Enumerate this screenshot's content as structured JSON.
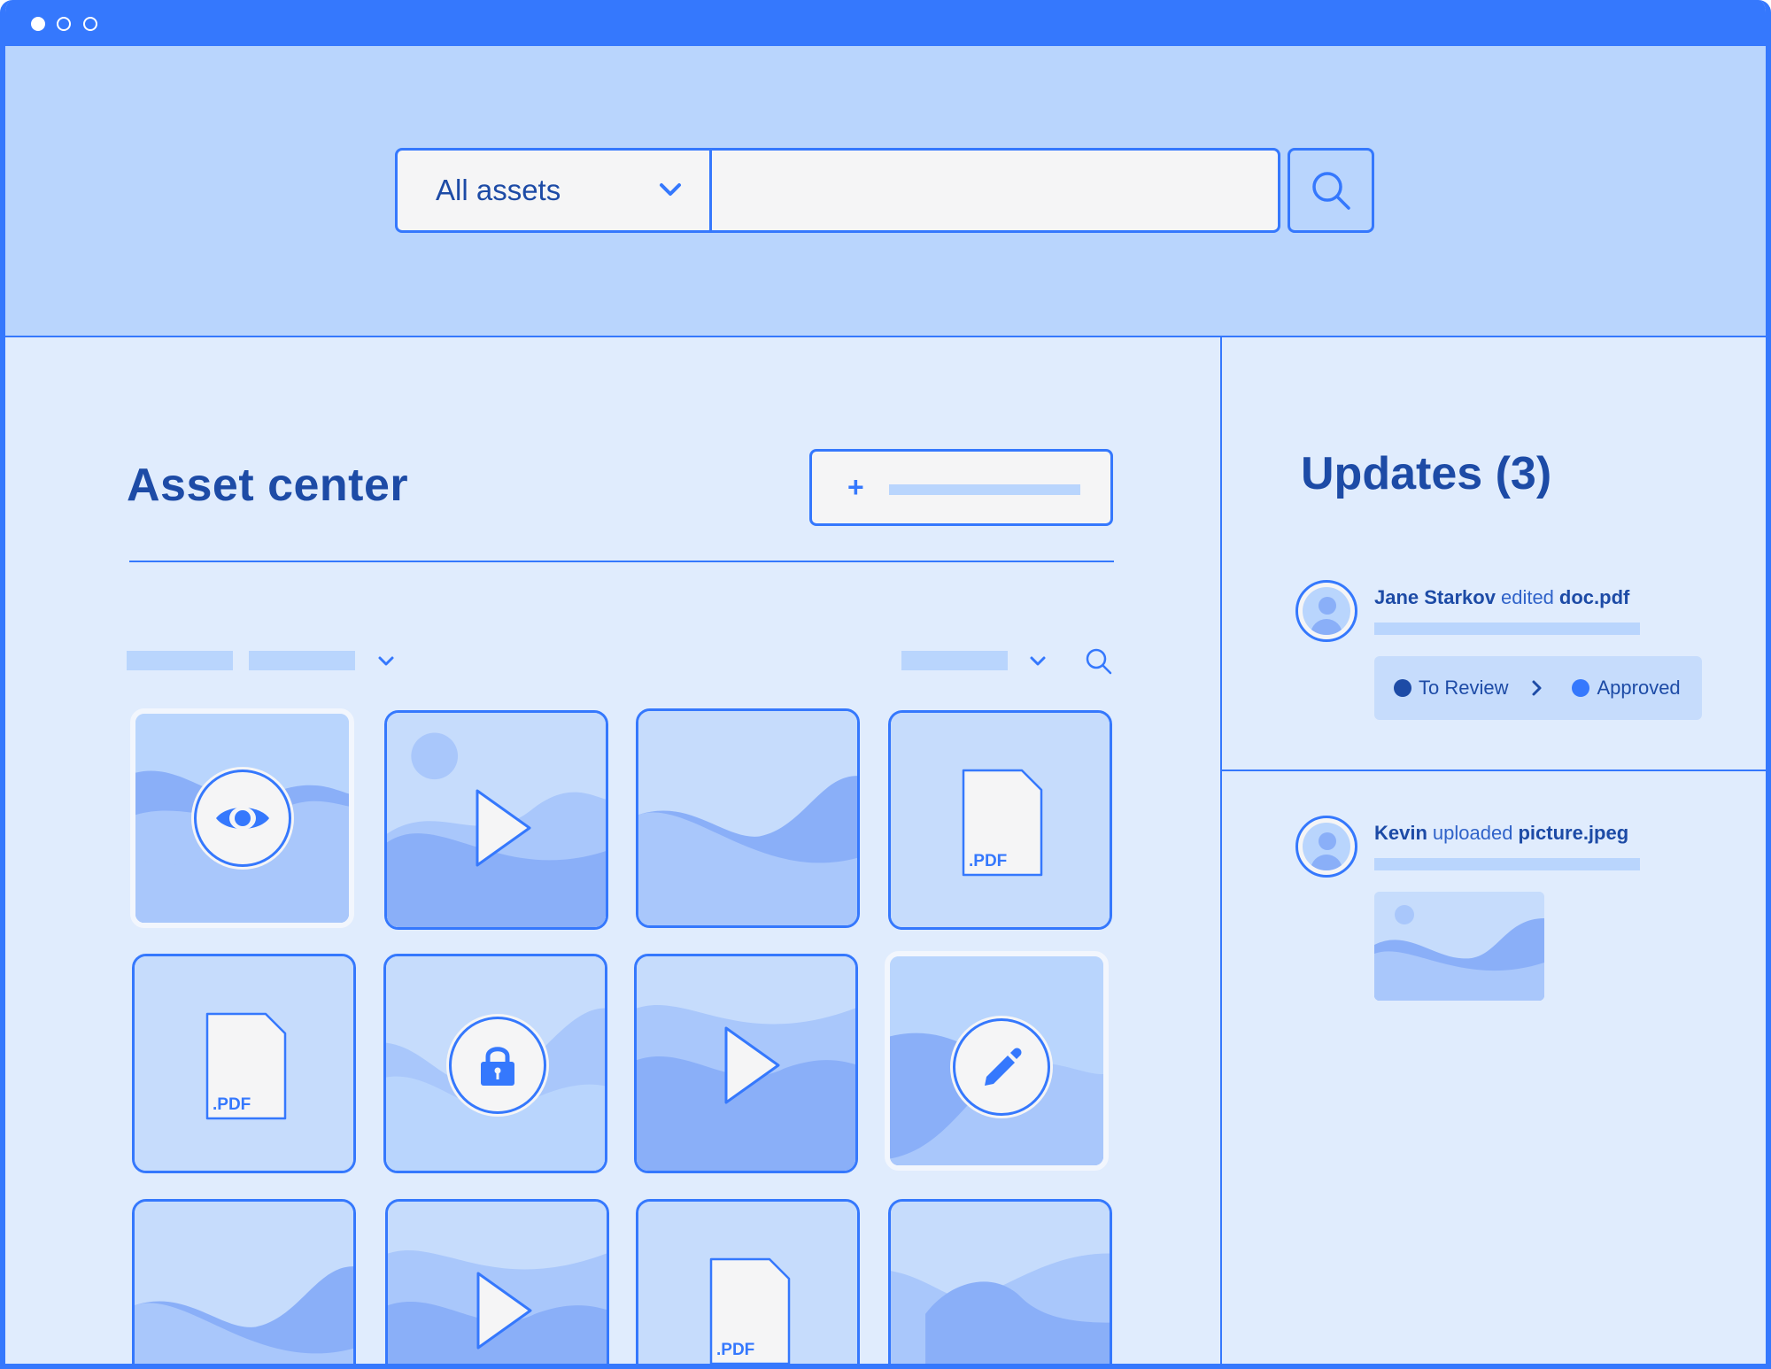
{
  "window": {
    "controls": [
      "close",
      "minimize",
      "maximize"
    ]
  },
  "search": {
    "scope_label": "All assets",
    "query_value": "",
    "button_icon": "search-icon"
  },
  "asset_center": {
    "title": "Asset center",
    "add_button_icon": "plus-icon",
    "add_button_label": "+",
    "tiles": [
      {
        "type": "image",
        "overlay": "eye-icon",
        "selected": true
      },
      {
        "type": "video",
        "overlay": "play-icon"
      },
      {
        "type": "image"
      },
      {
        "type": "pdf",
        "label": ".PDF"
      },
      {
        "type": "pdf",
        "label": ".PDF"
      },
      {
        "type": "image",
        "overlay": "lock-icon"
      },
      {
        "type": "video",
        "overlay": "play-icon"
      },
      {
        "type": "image",
        "overlay": "pencil-icon",
        "selected": true
      },
      {
        "type": "image"
      },
      {
        "type": "video",
        "overlay": "play-icon"
      },
      {
        "type": "pdf",
        "label": ".PDF"
      },
      {
        "type": "image"
      }
    ]
  },
  "updates": {
    "title": "Updates (3)",
    "items": [
      {
        "user": "Jane Starkov",
        "verb": "edited",
        "target": "doc.pdf",
        "status_from": "To Review",
        "status_to": "Approved"
      },
      {
        "user": "Kevin",
        "verb": "uploaded",
        "target": "picture.jpeg"
      }
    ]
  },
  "colors": {
    "accent": "#3578fd",
    "header_bg": "#b9d5fd",
    "content_bg": "#e0ecfd",
    "text_dark": "#1d4ba6",
    "status_from_dot": "#1d4ba6",
    "status_to_dot": "#3578fd"
  }
}
